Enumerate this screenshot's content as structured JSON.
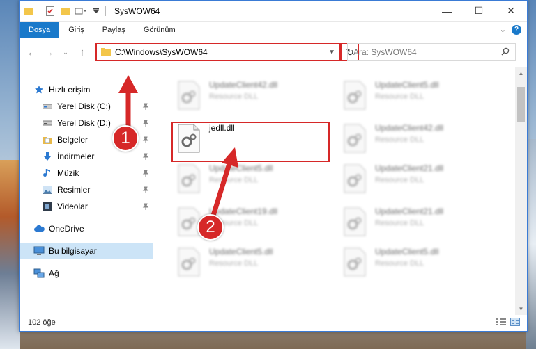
{
  "window": {
    "title": "SysWOW64",
    "controls": {
      "minimize": "—",
      "maximize": "☐",
      "close": "✕"
    }
  },
  "ribbon": {
    "tabs": [
      {
        "label": "Dosya",
        "active": true
      },
      {
        "label": "Giriş",
        "active": false
      },
      {
        "label": "Paylaş",
        "active": false
      },
      {
        "label": "Görünüm",
        "active": false
      }
    ],
    "expand": "⌄",
    "help": "?"
  },
  "nav": {
    "address": "C:\\Windows\\SysWOW64",
    "search_placeholder": "Ara: SysWOW64"
  },
  "sidebar": {
    "items": [
      {
        "label": "Hızlı erişim",
        "icon": "star-icon",
        "sub": false,
        "pinned": false
      },
      {
        "label": "Yerel Disk (C:)",
        "icon": "drive-icon",
        "sub": true,
        "pinned": true
      },
      {
        "label": "Yerel Disk (D:)",
        "icon": "drive-icon",
        "sub": true,
        "pinned": true
      },
      {
        "label": "Belgeler",
        "icon": "documents-icon",
        "sub": true,
        "pinned": true
      },
      {
        "label": "İndirmeler",
        "icon": "download-icon",
        "sub": true,
        "pinned": true
      },
      {
        "label": "Müzik",
        "icon": "music-icon",
        "sub": true,
        "pinned": true
      },
      {
        "label": "Resimler",
        "icon": "pictures-icon",
        "sub": true,
        "pinned": true
      },
      {
        "label": "Videolar",
        "icon": "video-icon",
        "sub": true,
        "pinned": true
      },
      {
        "label": "OneDrive",
        "icon": "cloud-icon",
        "sub": false,
        "pinned": false
      },
      {
        "label": "Bu bilgisayar",
        "icon": "computer-icon",
        "sub": false,
        "pinned": false,
        "selected": true
      },
      {
        "label": "Ağ",
        "icon": "network-icon",
        "sub": false,
        "pinned": false
      }
    ]
  },
  "files": [
    {
      "name": "UpdateClient42.dll",
      "type": "Resource DLL",
      "blurred": true
    },
    {
      "name": "UpdateClient5.dll",
      "type": "Resource DLL",
      "blurred": true
    },
    {
      "name": "jedll.dll",
      "type": "",
      "blurred": false
    },
    {
      "name": "UpdateClient42.dll",
      "type": "Resource DLL",
      "blurred": true
    },
    {
      "name": "UpdateClient5.dll",
      "type": "Resource DLL",
      "blurred": true
    },
    {
      "name": "UpdateClient21.dll",
      "type": "Resource DLL",
      "blurred": true
    },
    {
      "name": "UpdateClient19.dll",
      "type": "Resource DLL",
      "blurred": true
    },
    {
      "name": "UpdateClient21.dll",
      "type": "Resource DLL",
      "blurred": true
    },
    {
      "name": "UpdateClient5.dll",
      "type": "Resource DLL",
      "blurred": true
    },
    {
      "name": "UpdateClient5.dll",
      "type": "Resource DLL",
      "blurred": true
    }
  ],
  "status": {
    "count": "102 öğe"
  },
  "markers": {
    "one": "1",
    "two": "2"
  },
  "colors": {
    "accent": "#1979ca",
    "highlight": "#d62828",
    "selected": "#cce4f7"
  }
}
